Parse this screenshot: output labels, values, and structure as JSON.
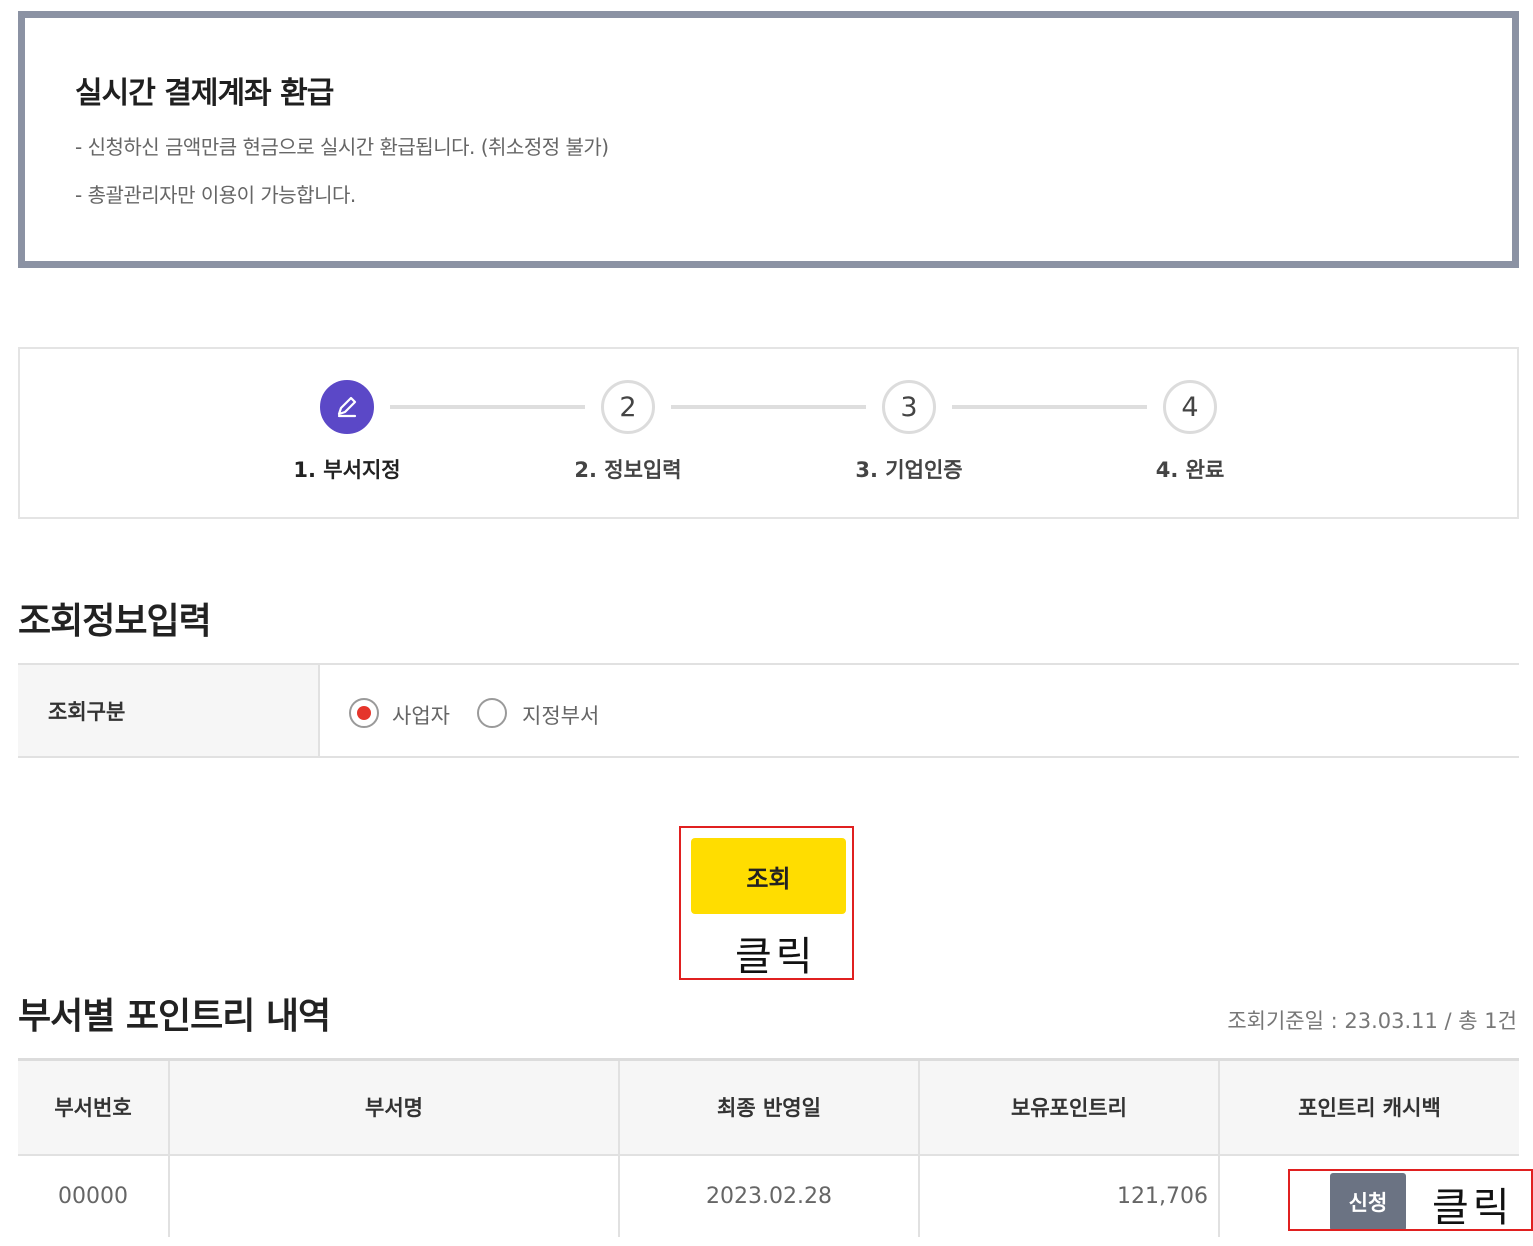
{
  "notice": {
    "title": "실시간 결제계좌 환급",
    "lines": [
      "- 신청하신 금액만큼 현금으로 실시간 환급됩니다. (취소정정 불가)",
      "- 총괄관리자만 이용이 가능합니다."
    ]
  },
  "stepper": {
    "steps": [
      {
        "number": "",
        "icon": "pencil-icon",
        "label": "1. 부서지정",
        "active": true
      },
      {
        "number": "2",
        "label": "2. 정보입력",
        "active": false
      },
      {
        "number": "3",
        "label": "3. 기업인증",
        "active": false
      },
      {
        "number": "4",
        "label": "4. 완료",
        "active": false
      }
    ]
  },
  "query": {
    "title": "조회정보입력",
    "label": "조회구분",
    "options": [
      {
        "label": "사업자",
        "checked": true
      },
      {
        "label": "지정부서",
        "checked": false
      }
    ],
    "search_button": "조회",
    "annotation": "클릭"
  },
  "points": {
    "title": "부서별 포인트리 내역",
    "meta": "조회기준일 : 23.03.11 / 총 1건",
    "columns": [
      "부서번호",
      "부서명",
      "최종 반영일",
      "보유포인트리",
      "포인트리 캐시백"
    ],
    "rows": [
      {
        "dept_no": "00000",
        "dept_name": "",
        "last_date": "2023.02.28",
        "points": "121,706",
        "action": "신청"
      }
    ],
    "annotation": "클릭"
  },
  "colors": {
    "accent": "#5b48c7",
    "search_button": "#ffdd00",
    "radio_checked": "#e5352b",
    "annotation_border": "#e02020",
    "apply_button": "#6b7383"
  }
}
